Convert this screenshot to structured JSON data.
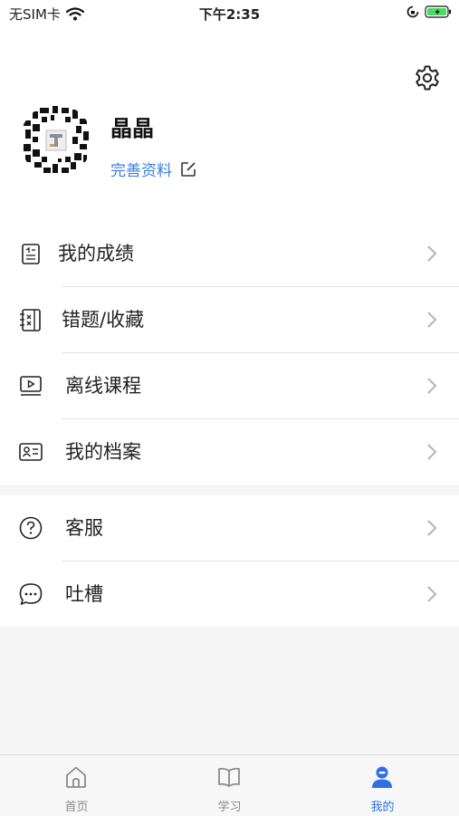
{
  "status_bar": {
    "carrier": "无SIM卡",
    "time": "下午2:35"
  },
  "profile": {
    "name": "晶晶",
    "complete_label": "完善资料"
  },
  "menu": [
    {
      "label": "我的成绩",
      "icon": "report-icon"
    },
    {
      "label": "错题/收藏",
      "icon": "notebook-icon"
    },
    {
      "label": "离线课程",
      "icon": "video-icon"
    },
    {
      "label": "我的档案",
      "icon": "id-card-icon"
    },
    {
      "label": "客服",
      "icon": "help-icon"
    },
    {
      "label": "吐槽",
      "icon": "chat-icon"
    }
  ],
  "tabs": [
    {
      "label": "首页",
      "icon": "home-icon",
      "active": false
    },
    {
      "label": "学习",
      "icon": "book-icon",
      "active": false
    },
    {
      "label": "我的",
      "icon": "user-icon",
      "active": true
    }
  ],
  "colors": {
    "accent": "#2f6fe4",
    "link": "#3a7de0",
    "battery": "#4cd964"
  }
}
